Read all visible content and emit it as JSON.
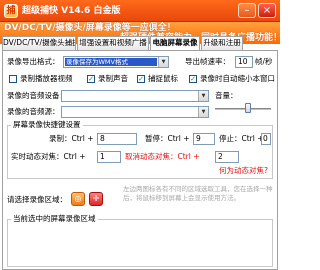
{
  "window": {
    "title": "超级捕快 V14.6 白金版",
    "min_glyph": "–",
    "close_glyph": "×"
  },
  "banner": {
    "line1": "DV/DC/TV/摄像头/屏幕录像等一应俱全！",
    "line2": "超强硬件兼容能力，同时具备广播功能！"
  },
  "tabs": [
    {
      "label": "DV/DC/TV/摄像头捕捉"
    },
    {
      "label": "增强设置和视频广播"
    },
    {
      "label": "电脑屏幕录像"
    },
    {
      "label": "升级和注册"
    }
  ],
  "form": {
    "format_label": "录像导出格式：",
    "format_value": "录像保存为WMV格式",
    "fps_label": "导出帧速率：",
    "fps_value": "10",
    "fps_unit": "帧/秒",
    "opt_player": "录制播放器视频",
    "opt_sound": "录制声音",
    "opt_cursor": "捕捉鼠标",
    "opt_autostop": "录像时自动缩小本窗口",
    "audio_device_label": "录像的音频设备：",
    "audio_source_label": "录像的音频源：",
    "volume_label": "音量：",
    "volume_level": 0.6
  },
  "hotkeys": {
    "group_title": "屏幕录像快捷键设置",
    "record_label": "录制：Ctrl +",
    "record_key": "8",
    "pause_label": "暂停：Ctrl +",
    "pause_key": "9",
    "stop_label": "停止：Ctrl +",
    "stop_key": "0",
    "realtime_label": "实时动态对焦：Ctrl +",
    "realtime_key": "1",
    "cancel_label": "取消动态对焦：Ctrl +",
    "cancel_key": "2",
    "howto_link": "何为动态对焦?"
  },
  "region": {
    "label": "请选择录像区域：",
    "hint": "左边两图标各有不同的区域选取工具，您在选择一种后，将鼠标移到屏幕上会显示使用方法。",
    "circle_glyph": "◎",
    "cross_glyph": "✛"
  },
  "current_group_title": "当前选中的屏幕录像区域",
  "colors": {
    "titlebar": "#ff6a1a",
    "banner": "#ff7a10",
    "selection": "#2a58c8",
    "red_label": "#e01010"
  }
}
